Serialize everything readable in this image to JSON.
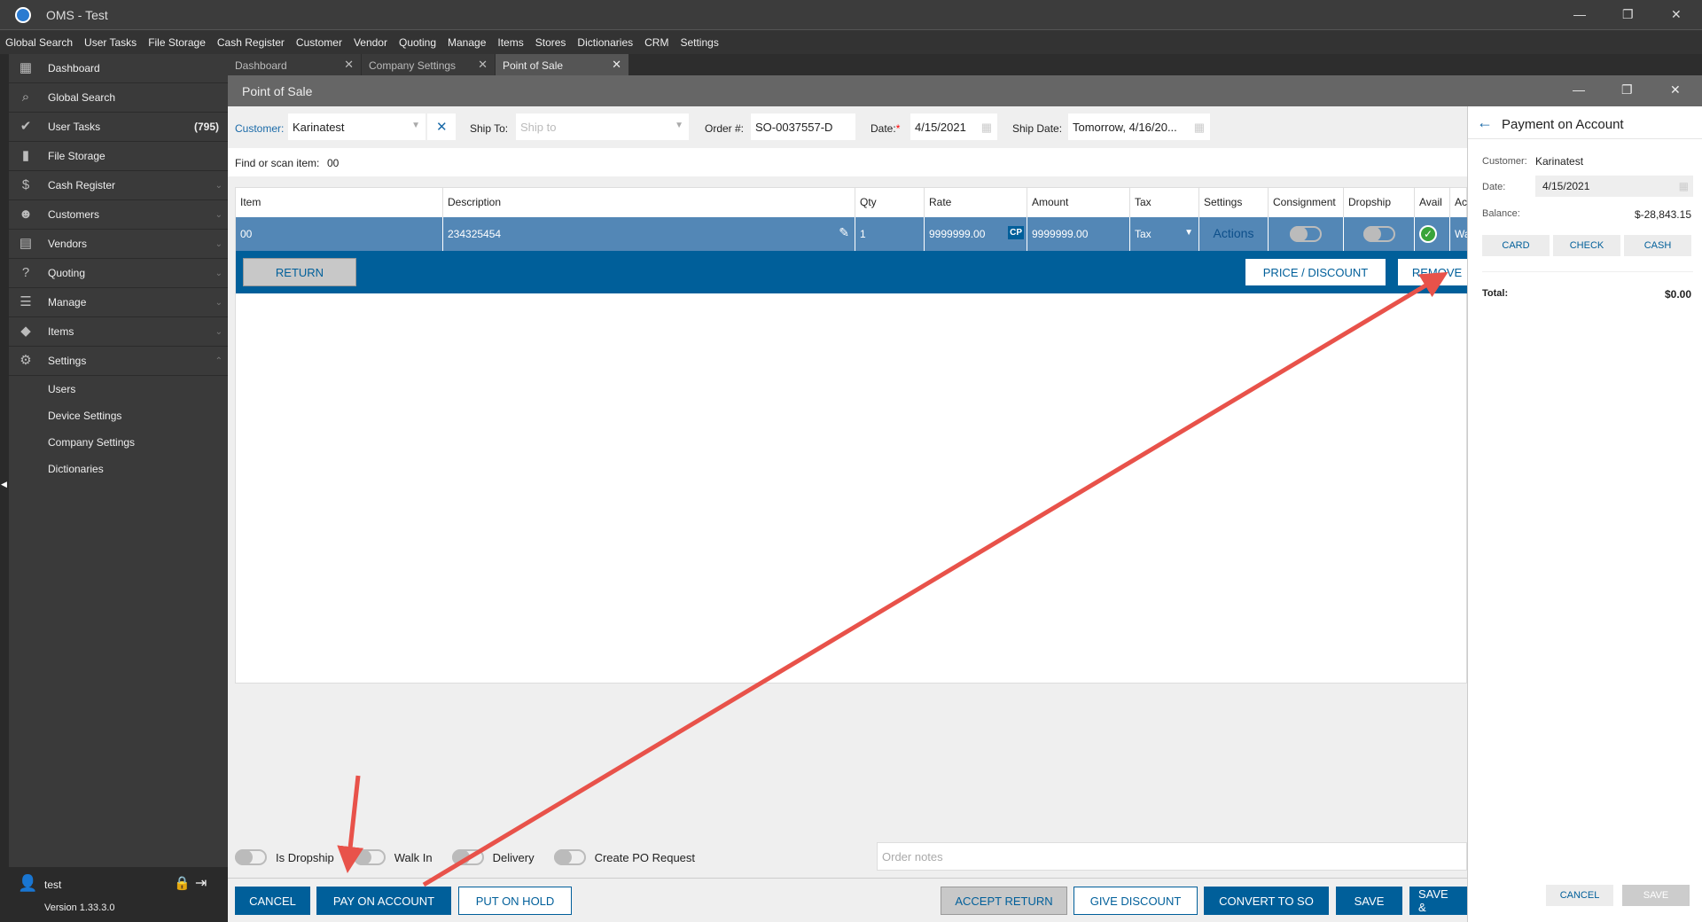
{
  "app": {
    "title": "OMS - Test",
    "minimize": "—",
    "restore": "❐",
    "close": "✕"
  },
  "menu": [
    "Global Search",
    "User Tasks",
    "File Storage",
    "Cash Register",
    "Customer",
    "Vendor",
    "Quoting",
    "Manage",
    "Items",
    "Stores",
    "Dictionaries",
    "CRM",
    "Settings"
  ],
  "sidebar": {
    "items": [
      {
        "label": "Dashboard",
        "icon": "▦"
      },
      {
        "label": "Global Search",
        "icon": "⌕"
      },
      {
        "label": "User Tasks",
        "icon": "✔",
        "count": "(795)"
      },
      {
        "label": "File Storage",
        "icon": "▮"
      },
      {
        "label": "Cash Register",
        "icon": "$",
        "chev": "⌄"
      },
      {
        "label": "Customers",
        "icon": "☻",
        "chev": "⌄"
      },
      {
        "label": "Vendors",
        "icon": "▤",
        "chev": "⌄"
      },
      {
        "label": "Quoting",
        "icon": "?",
        "chev": "⌄"
      },
      {
        "label": "Manage",
        "icon": "☰",
        "chev": "⌄"
      },
      {
        "label": "Items",
        "icon": "◆",
        "chev": "⌄"
      },
      {
        "label": "Settings",
        "icon": "⚙",
        "chev": "⌃"
      }
    ],
    "sub": [
      "Users",
      "Device Settings",
      "Company Settings",
      "Dictionaries"
    ],
    "user": "test",
    "version": "Version 1.33.3.0"
  },
  "tabs": [
    {
      "label": "Dashboard"
    },
    {
      "label": "Company Settings"
    },
    {
      "label": "Point of Sale"
    }
  ],
  "pos": {
    "title": "Point of Sale",
    "customer_label": "Customer:",
    "customer": "Karinatest",
    "shipto_label": "Ship To:",
    "shipto_placeholder": "Ship to",
    "order_label": "Order #:",
    "order": "SO-0037557-D",
    "date_label": "Date:",
    "date": "4/15/2021",
    "shipdate_label": "Ship Date:",
    "shipdate": "Tomorrow, 4/16/20...",
    "find_label": "Find or scan item:",
    "find_value": "00"
  },
  "grid": {
    "headers": [
      "Item",
      "Description",
      "Qty",
      "Rate",
      "Amount",
      "Tax",
      "Settings",
      "Consignment",
      "Dropship",
      "Avail",
      "Act"
    ],
    "row": {
      "item": "00",
      "description": "234325454",
      "qty": "1",
      "rate": "9999999.00",
      "cp": "CP",
      "amount": "9999999.00",
      "tax": "Tax",
      "settings": "Actions",
      "act": "Wa"
    },
    "return": "RETURN",
    "price_discount": "PRICE / DISCOUNT",
    "remove": "REMOVE"
  },
  "options": {
    "dropship": "Is Dropship",
    "walkin": "Walk In",
    "delivery": "Delivery",
    "po": "Create PO Request",
    "notes_placeholder": "Order notes"
  },
  "footer": {
    "cancel": "CANCEL",
    "pay": "PAY ON ACCOUNT",
    "hold": "PUT ON HOLD",
    "accept": "ACCEPT RETURN",
    "discount": "GIVE DISCOUNT",
    "convert": "CONVERT TO SO",
    "save": "SAVE",
    "save_and": "SAVE &"
  },
  "payment": {
    "title": "Payment on Account",
    "customer_label": "Customer:",
    "customer": "Karinatest",
    "date_label": "Date:",
    "date": "4/15/2021",
    "balance_label": "Balance:",
    "balance": "$-28,843.15",
    "card": "CARD",
    "check": "CHECK",
    "cash": "CASH",
    "total_label": "Total:",
    "total": "$0.00",
    "cancel": "CANCEL",
    "save": "SAVE"
  },
  "colors": {
    "accent": "#005f9a",
    "row": "#5387b6",
    "arrow": "#e8524a"
  }
}
